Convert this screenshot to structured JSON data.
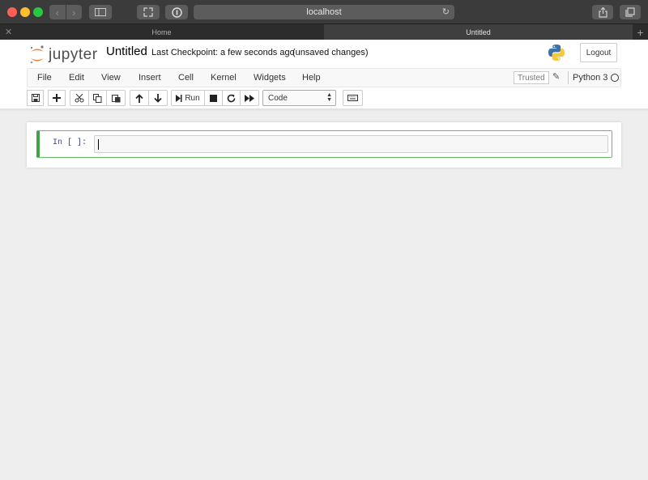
{
  "browser": {
    "url": "localhost",
    "tabs": [
      {
        "label": "Home",
        "active": false
      },
      {
        "label": "Untitled",
        "active": true
      }
    ]
  },
  "header": {
    "logo_text": "jupyter",
    "notebook_title": "Untitled",
    "checkpoint": "Last Checkpoint: a few seconds ago",
    "save_status": "(unsaved changes)",
    "logout_label": "Logout"
  },
  "menu": {
    "items": [
      "File",
      "Edit",
      "View",
      "Insert",
      "Cell",
      "Kernel",
      "Widgets",
      "Help"
    ],
    "trusted_label": "Trusted",
    "kernel_name": "Python 3"
  },
  "toolbar": {
    "run_label": "Run",
    "cell_type": "Code"
  },
  "cell": {
    "prompt": "In [ ]:",
    "content": ""
  },
  "colors": {
    "accent_orange": "#f37726",
    "cell_edit_border": "#66bb6a",
    "prompt_blue": "#303f9f"
  }
}
